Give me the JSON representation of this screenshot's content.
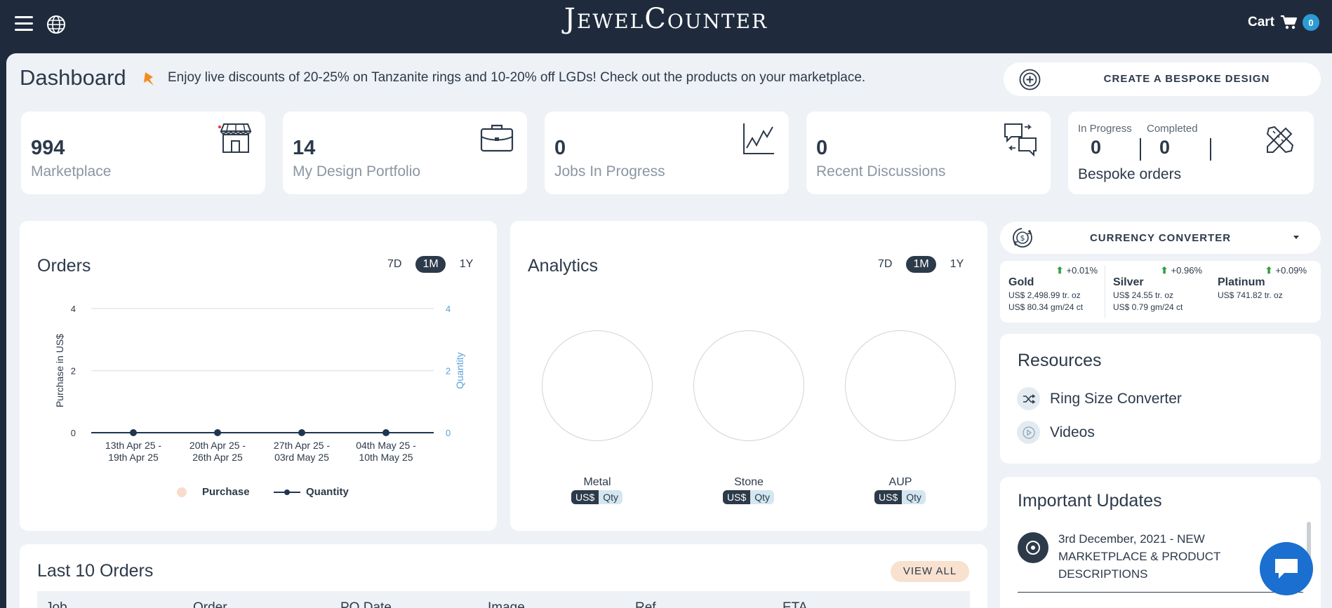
{
  "header": {
    "logo_text": "JewelCounter",
    "cart_label": "Cart",
    "cart_count": "0"
  },
  "page": {
    "title": "Dashboard",
    "promo": "Enjoy live discounts of 20-25% on Tanzanite rings and 10-20% off LGDs! Check out the products on your marketplace.",
    "bespoke_button": "CREATE A BESPOKE DESIGN"
  },
  "stats": [
    {
      "value": "994",
      "label": "Marketplace",
      "icon": "store-icon"
    },
    {
      "value": "14",
      "label": "My Design Portfolio",
      "icon": "briefcase-icon"
    },
    {
      "value": "0",
      "label": "Jobs In Progress",
      "icon": "line-chart-icon"
    },
    {
      "value": "0",
      "label": "Recent Discussions",
      "icon": "chat-bubbles-icon"
    }
  ],
  "bespoke_orders": {
    "in_progress_label": "In Progress",
    "in_progress_value": "0",
    "completed_label": "Completed",
    "completed_value": "0",
    "label": "Bespoke orders",
    "icon": "pencil-ruler-icon"
  },
  "orders": {
    "title": "Orders",
    "ranges": [
      "7D",
      "1M",
      "1Y"
    ],
    "selected_range": "1M"
  },
  "chart_data": {
    "type": "line",
    "title": "Orders",
    "categories": [
      [
        "13th Apr 25 -",
        "19th Apr 25"
      ],
      [
        "20th Apr 25 -",
        "26th Apr 25"
      ],
      [
        "27th Apr 25 -",
        "03rd May 25"
      ],
      [
        "04th May 25 -",
        "10th May 25"
      ]
    ],
    "series": [
      {
        "name": "Purchase",
        "values": [
          0,
          0,
          0,
          0
        ],
        "color": "#f8dccb"
      },
      {
        "name": "Quantity",
        "values": [
          0,
          0,
          0,
          0
        ],
        "color": "#1f3550"
      }
    ],
    "ylabel": "Purchase in US$",
    "y2label": "Quantity",
    "ylim": [
      0,
      4
    ],
    "yticks": [
      0,
      2,
      4
    ],
    "y2ticks": [
      0,
      2,
      4
    ],
    "grid": true,
    "legend": "bottom"
  },
  "analytics": {
    "title": "Analytics",
    "ranges": [
      "7D",
      "1M",
      "1Y"
    ],
    "selected_range": "1M",
    "rings": [
      {
        "label": "Metal",
        "opt_a": "US$",
        "opt_b": "Qty"
      },
      {
        "label": "Stone",
        "opt_a": "US$",
        "opt_b": "Qty"
      },
      {
        "label": "AUP",
        "opt_a": "US$",
        "opt_b": "Qty"
      }
    ]
  },
  "currency": {
    "title": "CURRENCY CONVERTER",
    "metals": [
      {
        "name": "Gold",
        "change": "+0.01%",
        "price1": "US$ 2,498.99 tr. oz",
        "price2": "US$ 80.34 gm/24 ct"
      },
      {
        "name": "Silver",
        "change": "+0.96%",
        "price1": "US$ 24.55 tr. oz",
        "price2": "US$ 0.79 gm/24 ct"
      },
      {
        "name": "Platinum",
        "change": "+0.09%",
        "price1": "US$ 741.82 tr. oz",
        "price2": ""
      }
    ]
  },
  "resources": {
    "title": "Resources",
    "items": [
      {
        "label": "Ring Size Converter",
        "icon": "shuffle-icon"
      },
      {
        "label": "Videos",
        "icon": "play-icon"
      }
    ]
  },
  "updates": {
    "title": "Important Updates",
    "items": [
      {
        "text": "3rd December, 2021 - NEW MARKETPLACE & PRODUCT DESCRIPTIONS"
      }
    ]
  },
  "last_orders": {
    "title": "Last 10 Orders",
    "view_all": "VIEW ALL",
    "columns": [
      "Job",
      "Order",
      "PO Date",
      "Image",
      "Ref",
      "ETA"
    ]
  }
}
